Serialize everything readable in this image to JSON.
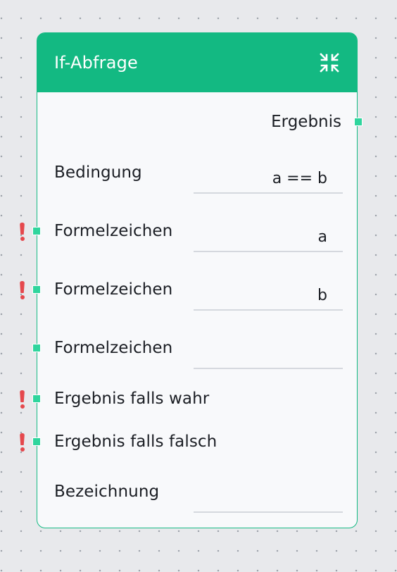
{
  "node": {
    "title": "If-Abfrage",
    "collapse_icon": "collapse-arrows-icon",
    "colors": {
      "header": "#13b982",
      "port": "#2fd59d",
      "warning": "#e5484d"
    },
    "output": {
      "label": "Ergebnis"
    },
    "rows": [
      {
        "label": "Bedingung",
        "value": "a == b",
        "has_port": false,
        "warning": false,
        "has_field": true
      },
      {
        "label": "Formelzeichen",
        "value": "a",
        "has_port": true,
        "warning": true,
        "has_field": true
      },
      {
        "label": "Formelzeichen",
        "value": "b",
        "has_port": true,
        "warning": true,
        "has_field": true
      },
      {
        "label": "Formelzeichen",
        "value": "",
        "has_port": true,
        "warning": false,
        "has_field": true
      },
      {
        "label": "Ergebnis falls wahr",
        "value": "",
        "has_port": true,
        "warning": true,
        "has_field": false
      },
      {
        "label": "Ergebnis falls falsch",
        "value": "",
        "has_port": true,
        "warning": true,
        "has_field": false
      },
      {
        "label": "Bezeichnung",
        "value": "",
        "has_port": false,
        "warning": false,
        "has_field": true
      }
    ]
  }
}
